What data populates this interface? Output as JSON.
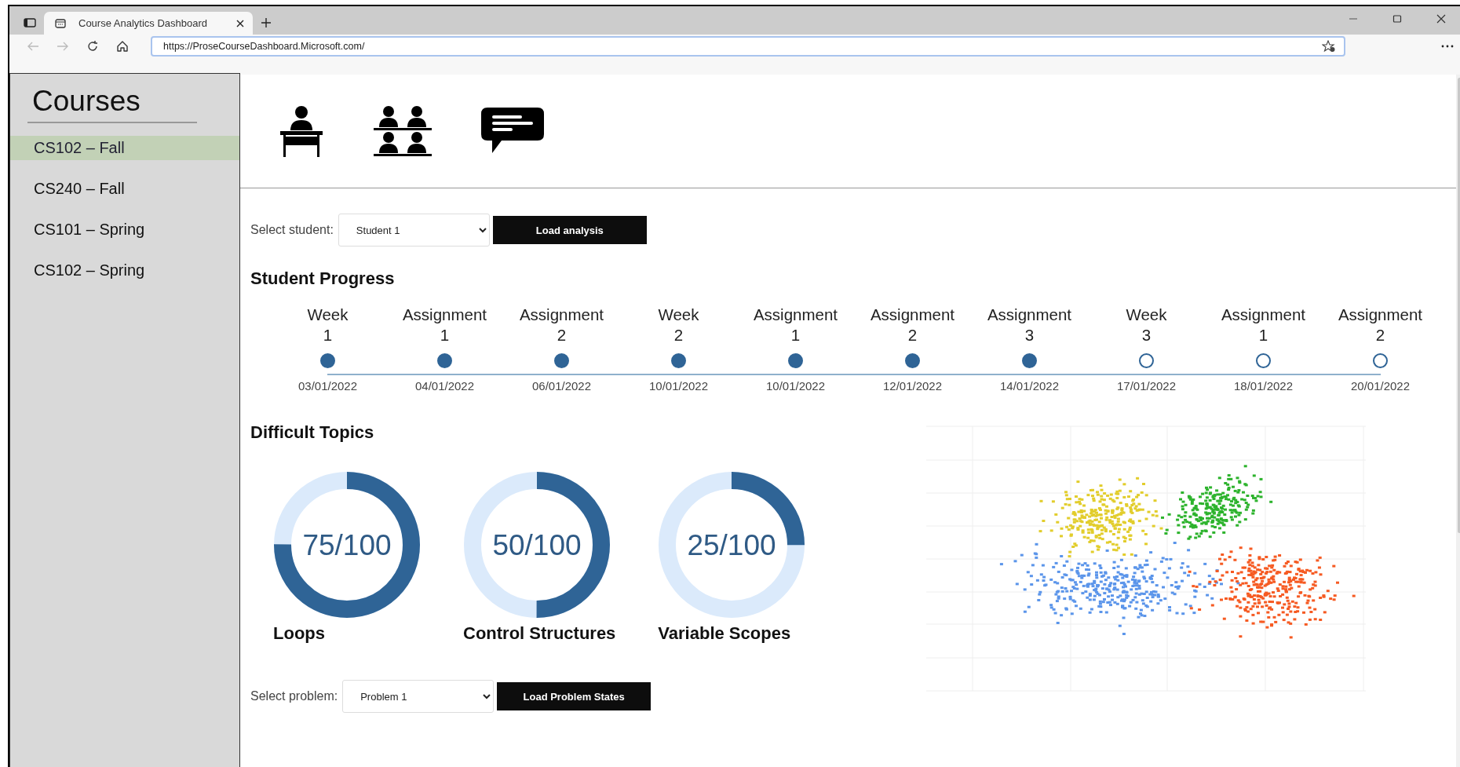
{
  "browser": {
    "tabs": [
      {
        "title": "Course Analytics Dashboard",
        "selected": true
      }
    ],
    "url": "https://ProseCourseDashboard.Microsoft.com/"
  },
  "sidebar": {
    "title": "Courses",
    "items": [
      {
        "label": "CS102 – Fall",
        "selected": true
      },
      {
        "label": "CS240 – Fall",
        "selected": false
      },
      {
        "label": "CS101 – Spring",
        "selected": false
      },
      {
        "label": "CS102 – Spring",
        "selected": false
      }
    ]
  },
  "student_select": {
    "label": "Select student:",
    "value": "Student 1",
    "button": "Load analysis"
  },
  "progress": {
    "title": "Student Progress",
    "milestones": [
      {
        "name": "Week",
        "number": "1",
        "date": "03/01/2022",
        "done": true
      },
      {
        "name": "Assignment",
        "number": "1",
        "date": "04/01/2022",
        "done": true
      },
      {
        "name": "Assignment",
        "number": "2",
        "date": "06/01/2022",
        "done": true
      },
      {
        "name": "Week",
        "number": "2",
        "date": "10/01/2022",
        "done": true
      },
      {
        "name": "Assignment",
        "number": "1",
        "date": "10/01/2022",
        "done": true
      },
      {
        "name": "Assignment",
        "number": "2",
        "date": "12/01/2022",
        "done": true
      },
      {
        "name": "Assignment",
        "number": "3",
        "date": "14/01/2022",
        "done": true
      },
      {
        "name": "Week",
        "number": "3",
        "date": "17/01/2022",
        "done": false
      },
      {
        "name": "Assignment",
        "number": "1",
        "date": "18/01/2022",
        "done": false
      },
      {
        "name": "Assignment",
        "number": "2",
        "date": "20/01/2022",
        "done": false
      }
    ]
  },
  "difficult_topics": {
    "title": "Difficult Topics",
    "topics": [
      {
        "name": "Loops",
        "value": "75/100",
        "level": 0.75
      },
      {
        "name": "Control Structures",
        "value": "50/100",
        "level": 0.5
      },
      {
        "name": "Variable Scopes",
        "value": "25/100",
        "level": 0.25
      }
    ],
    "scatter": {
      "clusters": [
        {
          "color": "#e2cd2c"
        },
        {
          "color": "#2db32d"
        },
        {
          "color": "#5b95ea"
        },
        {
          "color": "#f65a22"
        }
      ]
    }
  },
  "problem_select": {
    "label": "Select problem:",
    "value": "Problem 1",
    "button": "Load Problem States"
  }
}
